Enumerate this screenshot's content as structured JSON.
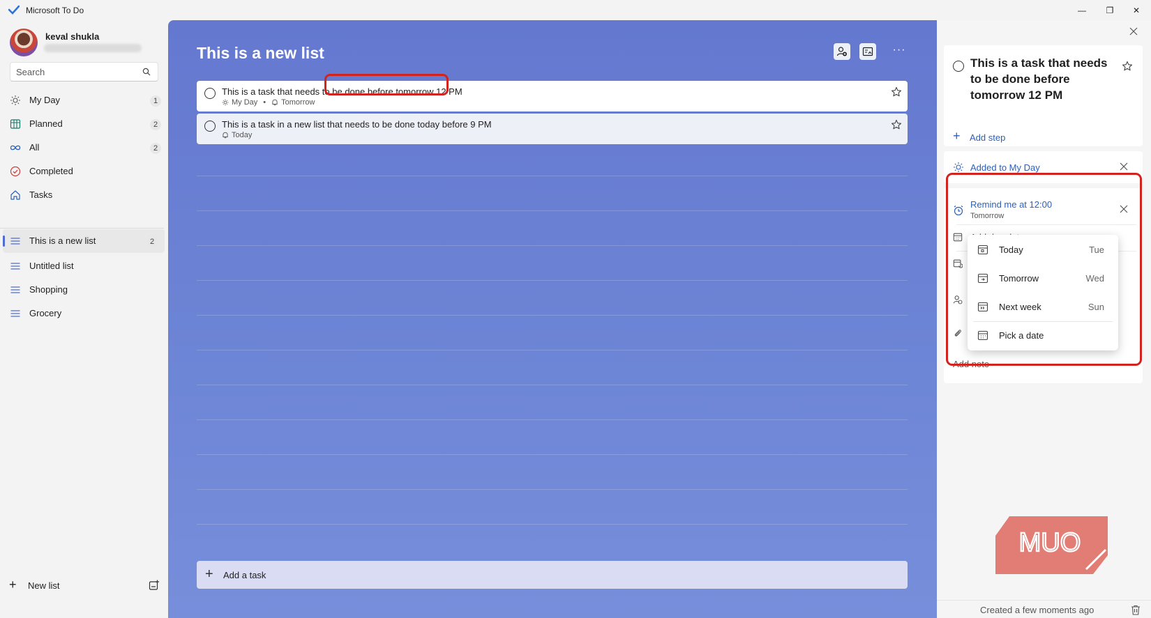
{
  "app": {
    "title": "Microsoft To Do"
  },
  "window": {
    "minimize": "—",
    "restore": "❐",
    "close": "✕"
  },
  "user": {
    "name": "keval shukla"
  },
  "search": {
    "placeholder": "Search"
  },
  "nav": [
    {
      "label": "My Day",
      "count": "1"
    },
    {
      "label": "Planned",
      "count": "2"
    },
    {
      "label": "All",
      "count": "2"
    },
    {
      "label": "Completed",
      "count": ""
    },
    {
      "label": "Tasks",
      "count": ""
    }
  ],
  "lists": [
    {
      "label": "This is a new list",
      "count": "2"
    },
    {
      "label": "Untitled list",
      "count": ""
    },
    {
      "label": "Shopping",
      "count": ""
    },
    {
      "label": "Grocery",
      "count": ""
    }
  ],
  "new_list": {
    "label": "New list"
  },
  "main": {
    "title": "This is a new list",
    "more": "···",
    "tasks": [
      {
        "title": "This is a task that needs to be done before tomorrow 12 PM",
        "meta_myday": "My Day",
        "meta_reminder": "Tomorrow"
      },
      {
        "title": "This is a task in a new list that needs to be done today before 9 PM",
        "meta_reminder": "Today"
      }
    ],
    "add_task": "Add a task"
  },
  "details": {
    "task_title": "This is a task that needs to be done before tomorrow 12 PM",
    "add_step": "Add step",
    "my_day": "Added to My Day",
    "reminder": "Remind me at 12:00",
    "reminder_sub": "Tomorrow",
    "due": "Add due date",
    "note": "Add note",
    "created": "Created a few moments ago"
  },
  "due_menu": [
    {
      "label": "Today",
      "day": "Tue"
    },
    {
      "label": "Tomorrow",
      "day": "Wed"
    },
    {
      "label": "Next week",
      "day": "Sun"
    },
    {
      "label": "Pick a date",
      "day": ""
    }
  ],
  "watermark": {
    "text": "MUO"
  },
  "colors": {
    "accent": "#2b5fb8",
    "list_bg": "#6478cf",
    "highlight": "#d3231f"
  }
}
